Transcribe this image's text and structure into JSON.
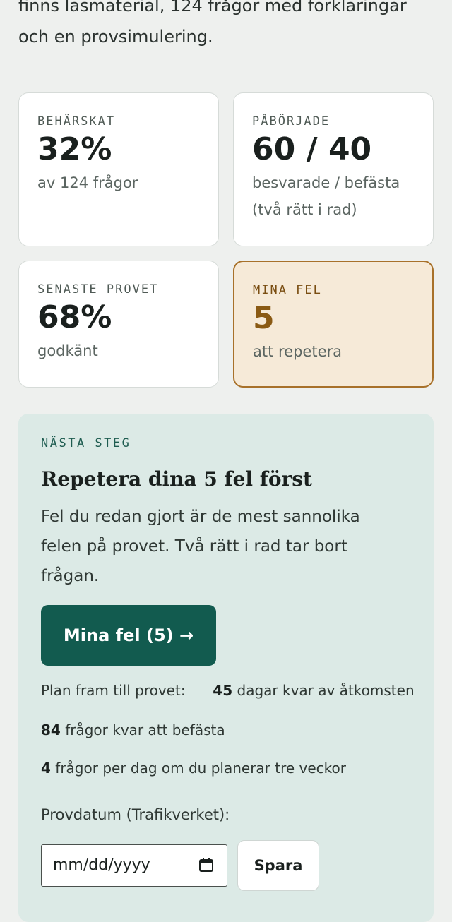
{
  "intro": {
    "text": "finns läsmaterial, 124 frågor med förklaringar och en provsimulering."
  },
  "stats": [
    {
      "label": "BEHÄRSKAT",
      "value": "32%",
      "sub": "av 124 frågor"
    },
    {
      "label": "PÅBÖRJADE",
      "value": "60 / 40",
      "sub": "besvarade / befästa (två rätt i rad)"
    },
    {
      "label": "SENASTE PROVET",
      "value": "68%",
      "sub": "godkänt"
    },
    {
      "label": "MINA FEL",
      "value": "5",
      "sub": "att repetera"
    }
  ],
  "next": {
    "kicker": "NÄSTA STEG",
    "title": "Repetera dina 5 fel först",
    "desc": "Fel du redan gjort är de mest sannolika felen på provet. Två rätt i rad tar bort frågan.",
    "cta": "Mina fel (5) →"
  },
  "plan": {
    "label": "Plan fram till provet:",
    "days": "45",
    "days_text": "dagar kvar av åtkomsten",
    "remaining": "84",
    "remaining_text": "frågor kvar att befästa",
    "per_day": "4",
    "per_day_text": "frågor per dag om du planerar tre veckor"
  },
  "date": {
    "label": "Provdatum (Trafikverket):",
    "placeholder": "mm/dd/yyyy",
    "save": "Spara"
  },
  "colors": {
    "accent": "#125b4f",
    "warn": "#8a5a14",
    "panel": "#dceae6"
  }
}
